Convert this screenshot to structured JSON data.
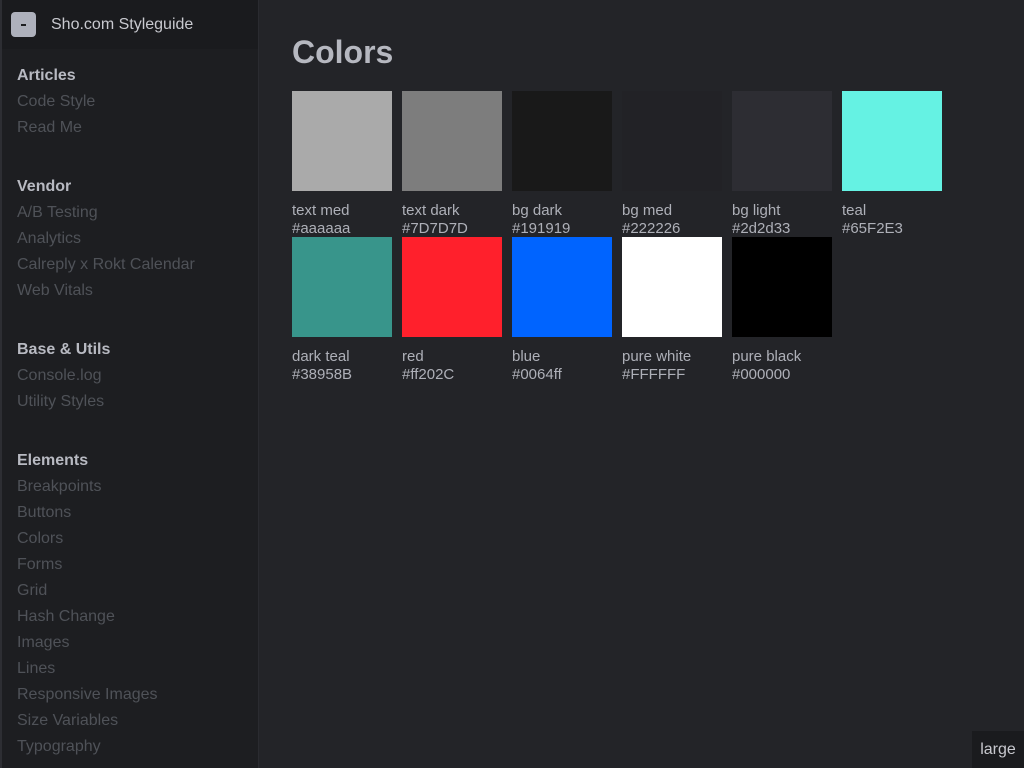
{
  "brand": {
    "title": "Sho.com Styleguide"
  },
  "sidebar": {
    "sections": [
      {
        "heading": "Articles",
        "items": [
          "Code Style",
          "Read Me"
        ]
      },
      {
        "heading": "Vendor",
        "items": [
          "A/B Testing",
          "Analytics",
          "Calreply x Rokt Calendar",
          "Web Vitals"
        ]
      },
      {
        "heading": "Base & Utils",
        "items": [
          "Console.log",
          "Utility Styles"
        ]
      },
      {
        "heading": "Elements",
        "items": [
          "Breakpoints",
          "Buttons",
          "Colors",
          "Forms",
          "Grid",
          "Hash Change",
          "Images",
          "Lines",
          "Responsive Images",
          "Size Variables",
          "Typography"
        ]
      }
    ]
  },
  "main": {
    "title": "Colors",
    "swatches": [
      {
        "name": "text med",
        "hex": "#aaaaaa",
        "color": "#aaaaaa"
      },
      {
        "name": "text dark",
        "hex": "#7D7D7D",
        "color": "#7D7D7D"
      },
      {
        "name": "bg dark",
        "hex": "#191919",
        "color": "#191919"
      },
      {
        "name": "bg med",
        "hex": "#222226",
        "color": "#222226"
      },
      {
        "name": "bg light",
        "hex": "#2d2d33",
        "color": "#2d2d33"
      },
      {
        "name": "teal",
        "hex": "#65F2E3",
        "color": "#65F2E3"
      },
      {
        "name": "dark teal",
        "hex": "#38958B",
        "color": "#38958B"
      },
      {
        "name": "red",
        "hex": "#ff202C",
        "color": "#ff202C"
      },
      {
        "name": "blue",
        "hex": "#0064ff",
        "color": "#0064ff"
      },
      {
        "name": "pure white",
        "hex": "#FFFFFF",
        "color": "#FFFFFF"
      },
      {
        "name": "pure black",
        "hex": "#000000",
        "color": "#000000"
      }
    ]
  },
  "breakpoint": {
    "label": "large"
  }
}
